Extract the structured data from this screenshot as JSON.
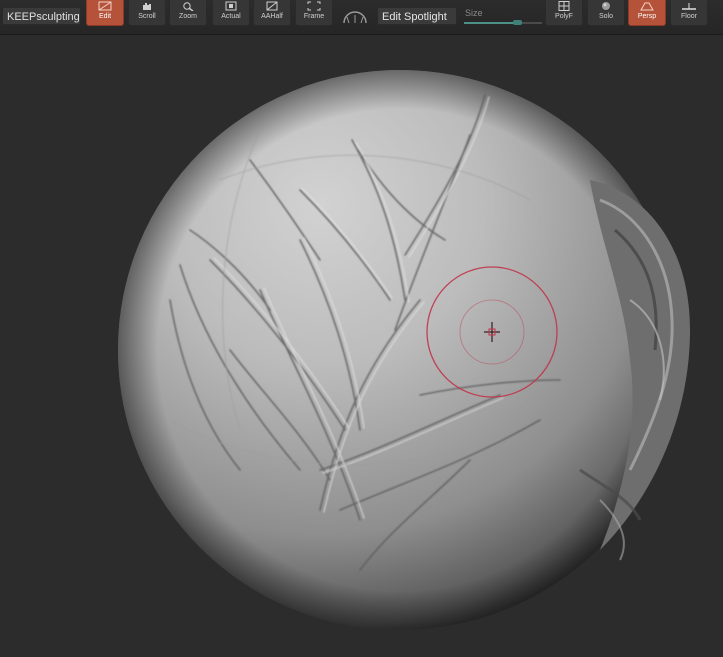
{
  "toolbar": {
    "brush_preset": "KEEPsculpting",
    "buttons": {
      "edit": "Edit",
      "scroll": "Scroll",
      "zoom": "Zoom",
      "actual": "Actual",
      "aahalf": "AAHalf",
      "frame": "Frame",
      "polyf": "PolyF",
      "solo": "Solo",
      "persp": "Persp",
      "floor": "Floor"
    },
    "spotlight": "Edit Spotlight",
    "size_label": "Size",
    "size_level": 0.68
  },
  "colors": {
    "accent_active": "#b4523a",
    "brush_cursor": "#c0334a",
    "canvas": "#2c2c2c",
    "slider": "#4b8f86"
  },
  "icons": {
    "edit": "edit-icon",
    "scroll": "scroll-icon",
    "zoom": "zoom-icon",
    "actual": "actual-icon",
    "aahalf": "aahalf-icon",
    "frame": "frame-icon",
    "polyf": "polyf-icon",
    "solo": "solo-icon",
    "persp": "persp-icon",
    "floor": "floor-icon",
    "gizmo": "gizmo-icon",
    "brush_cursor": "brush-cursor"
  }
}
